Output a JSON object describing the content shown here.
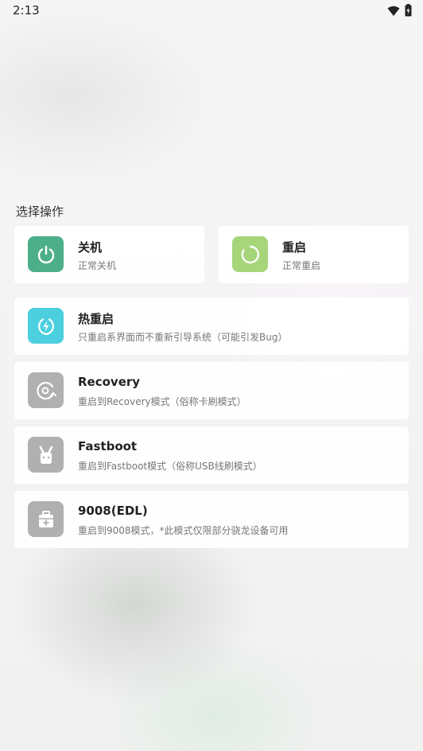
{
  "status_bar": {
    "time": "2:13"
  },
  "section": {
    "title": "选择操作"
  },
  "actions": [
    {
      "id": "power-off",
      "title": "关机",
      "subtitle": "正常关机",
      "icon": "power-icon",
      "color": "#4caf8a"
    },
    {
      "id": "reboot",
      "title": "重启",
      "subtitle": "正常重启",
      "icon": "refresh-icon",
      "color": "#a6d57a"
    },
    {
      "id": "hot-reboot",
      "title": "热重启",
      "subtitle": "只重启系界面而不重新引导系统（可能引发Bug）",
      "icon": "bolt-icon",
      "color": "#4ccfdf"
    },
    {
      "id": "recovery",
      "title": "Recovery",
      "subtitle": "重启到Recovery模式（俗称卡刷模式）",
      "icon": "recovery-icon",
      "color": "#b0b0b0"
    },
    {
      "id": "fastboot",
      "title": "Fastboot",
      "subtitle": "重启到Fastboot模式（俗称USB线刷模式）",
      "icon": "bunny-icon",
      "color": "#b0b0b0"
    },
    {
      "id": "edl",
      "title": "9008(EDL)",
      "subtitle": "重启到9008模式，*此模式仅限部分骁龙设备可用",
      "icon": "toolbox-icon",
      "color": "#b0b0b0"
    }
  ]
}
